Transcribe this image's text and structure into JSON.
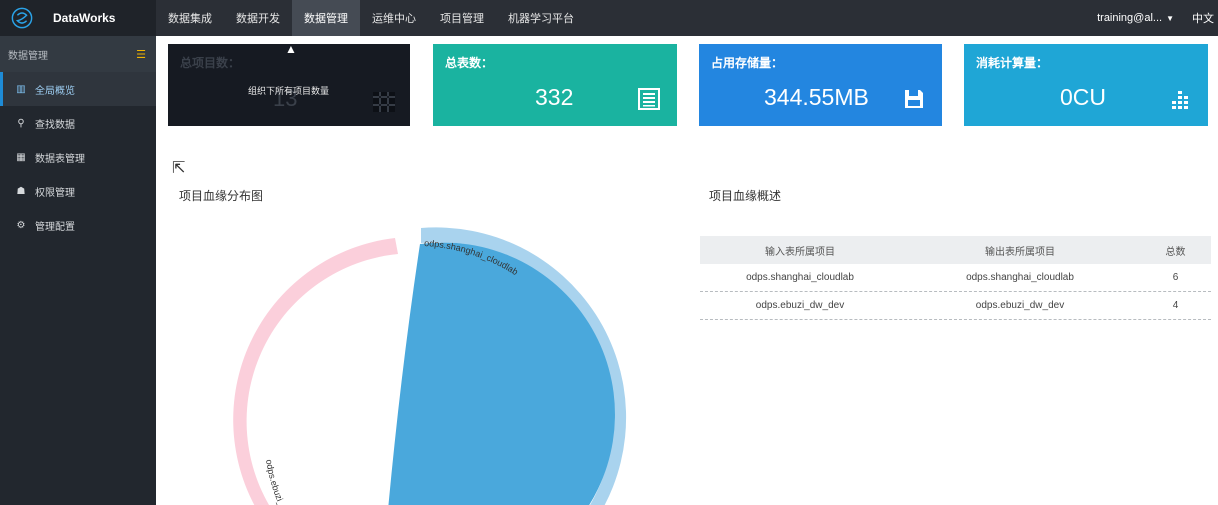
{
  "topbar": {
    "brand": "DataWorks",
    "nav": [
      "数据集成",
      "数据开发",
      "数据管理",
      "运维中心",
      "项目管理",
      "机器学习平台"
    ],
    "active_nav": "数据管理",
    "user": "training@al...",
    "lang": "中文"
  },
  "sidebar": {
    "title": "数据管理",
    "items": [
      {
        "label": "全局概览",
        "icon": "bar-chart-icon",
        "active": true
      },
      {
        "label": "查找数据",
        "icon": "search-icon",
        "active": false
      },
      {
        "label": "数据表管理",
        "icon": "table-icon",
        "active": false
      },
      {
        "label": "权限管理",
        "icon": "users-icon",
        "active": false
      },
      {
        "label": "管理配置",
        "icon": "gears-icon",
        "active": false
      }
    ]
  },
  "cards": {
    "projects": {
      "label": "总项目数：",
      "value": "13",
      "tooltip": "组织下所有项目数量"
    },
    "tables": {
      "label": "总表数：",
      "value": "332"
    },
    "storage": {
      "label": "占用存储量：",
      "value": "344.55MB"
    },
    "compute": {
      "label": "消耗计算量：",
      "value": "0CU"
    }
  },
  "sections": {
    "chart_title": "项目血缘分布图",
    "table_title": "项目血缘概述"
  },
  "lineage_table": {
    "headers": [
      "输入表所属项目",
      "输出表所属项目",
      "总数"
    ],
    "rows": [
      [
        "odps.shanghai_cloudlab",
        "odps.shanghai_cloudlab",
        "6"
      ],
      [
        "odps.ebuzi_dw_dev",
        "odps.ebuzi_dw_dev",
        "4"
      ]
    ]
  },
  "chord": {
    "labels": [
      "odps.shanghai_cloudlab",
      "odps.ebuzi_dw_dev"
    ],
    "colors": {
      "main_fill": "#4aa8dc",
      "main_ring": "#a9d3ee",
      "other_ring": "#fbcfdb"
    }
  }
}
